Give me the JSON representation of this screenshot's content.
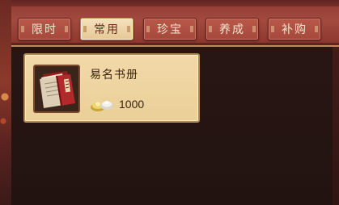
{
  "tabs": [
    {
      "label": "限时",
      "active": false
    },
    {
      "label": "常用",
      "active": true
    },
    {
      "label": "珍宝",
      "active": false
    },
    {
      "label": "养成",
      "active": false
    },
    {
      "label": "补购",
      "active": false
    }
  ],
  "items": [
    {
      "name": "易名书册",
      "icon": "red-book-icon",
      "currency_icon": "gold-ingot-icon",
      "price": "1000"
    }
  ],
  "colors": {
    "tab_bar": "#a34a3e",
    "tab_active": "#f4e1bc",
    "card_bg": "#f1d9a8",
    "panel_bg": "#221311"
  }
}
